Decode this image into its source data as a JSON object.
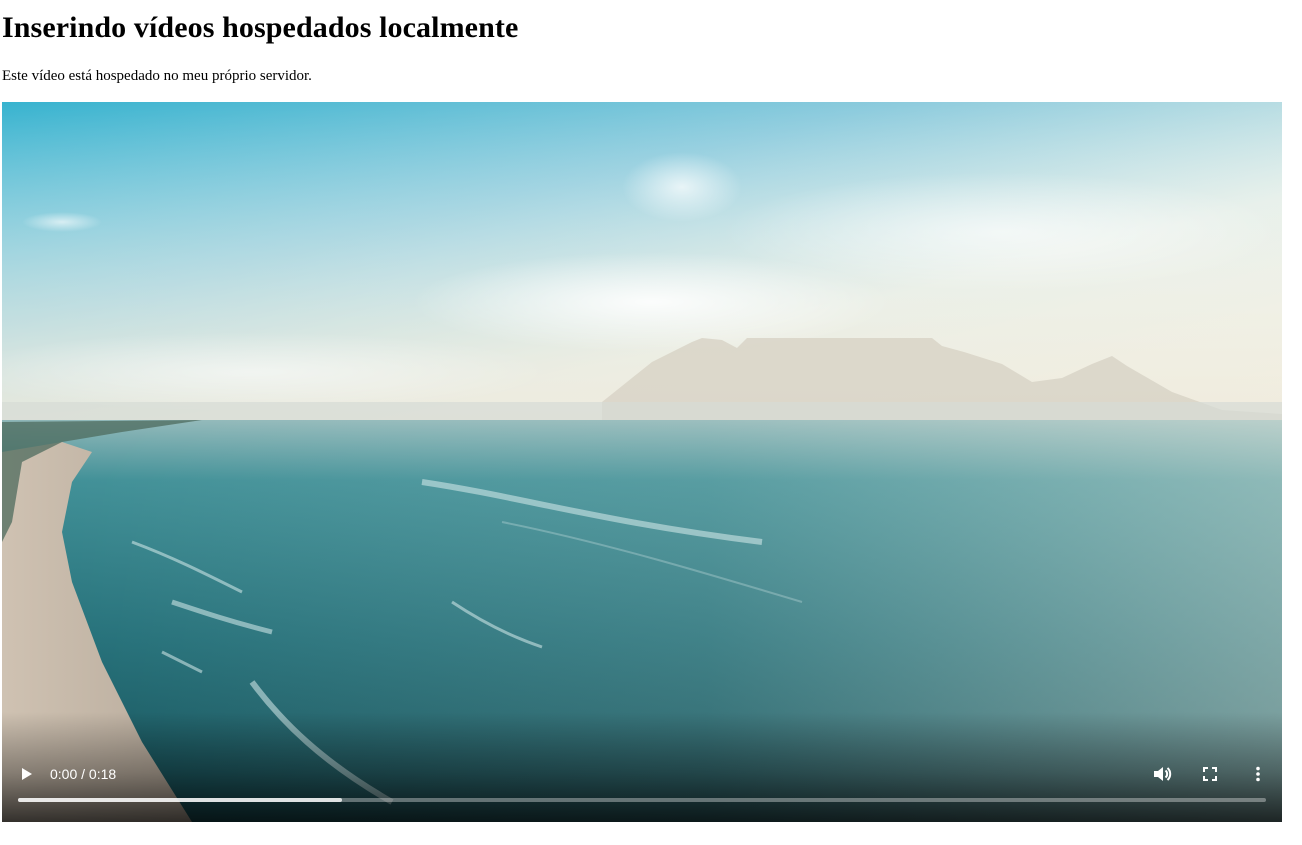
{
  "heading": "Inserindo vídeos hospedados localmente",
  "paragraph": "Este vídeo está hospedado no meu próprio servidor.",
  "video": {
    "time": "0:00 / 0:18",
    "buffered_fraction": 0.26,
    "icons": {
      "play": "play-icon",
      "volume": "volume-icon",
      "fullscreen": "fullscreen-icon",
      "more": "more-options-icon"
    }
  }
}
